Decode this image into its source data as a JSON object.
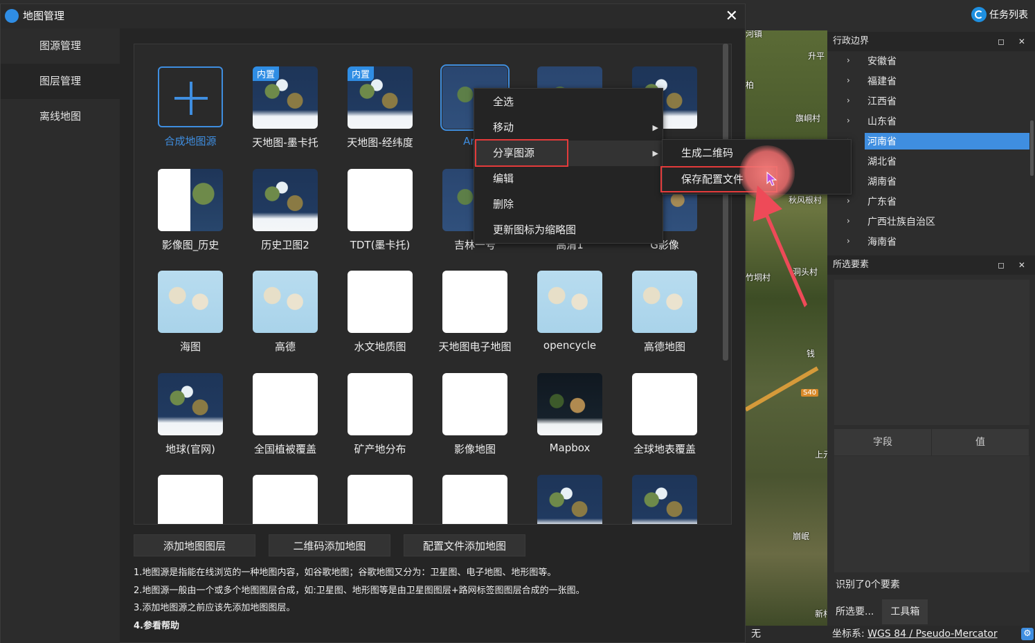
{
  "app": {
    "task_list_label": "任务列表"
  },
  "dialog": {
    "title": "地图管理",
    "close_glyph": "✕",
    "nav": [
      {
        "label": "图源管理"
      },
      {
        "label": "图层管理"
      },
      {
        "label": "离线地图"
      }
    ],
    "add_source_label": "合成地图源",
    "builtin_badge": "内置",
    "tiles": [
      {
        "label": "天地图-墨卡托",
        "builtin": true,
        "style": "sat"
      },
      {
        "label": "天地图-经纬度",
        "builtin": true,
        "style": "sat"
      },
      {
        "label": "Arcg",
        "builtin": false,
        "style": "sat2"
      },
      {
        "label": "",
        "builtin": false,
        "style": "sat2"
      },
      {
        "label": "",
        "builtin": false,
        "style": "sat"
      },
      {
        "label": "影像图_历史",
        "builtin": false,
        "style": "mix"
      },
      {
        "label": "历史卫图2",
        "builtin": false,
        "style": "sat"
      },
      {
        "label": "TDT(墨卡托)",
        "builtin": false,
        "style": "white"
      },
      {
        "label": "吉林一号",
        "builtin": false,
        "style": "sat2"
      },
      {
        "label": "高清1",
        "builtin": false,
        "style": "sat2"
      },
      {
        "label": "G影像",
        "builtin": false,
        "style": "sat2"
      },
      {
        "label": "海图",
        "builtin": false,
        "style": "light"
      },
      {
        "label": "高德",
        "builtin": false,
        "style": "light"
      },
      {
        "label": "水文地质图",
        "builtin": false,
        "style": "white"
      },
      {
        "label": "天地图电子地图",
        "builtin": false,
        "style": "white"
      },
      {
        "label": "opencycle",
        "builtin": false,
        "style": "light"
      },
      {
        "label": "高德地图",
        "builtin": false,
        "style": "light"
      },
      {
        "label": "地球(官网)",
        "builtin": false,
        "style": "sat"
      },
      {
        "label": "全国植被覆盖",
        "builtin": false,
        "style": "white"
      },
      {
        "label": "矿产地分布",
        "builtin": false,
        "style": "white"
      },
      {
        "label": "影像地图",
        "builtin": false,
        "style": "white"
      },
      {
        "label": "Mapbox",
        "builtin": false,
        "style": "dark"
      },
      {
        "label": "全球地表覆盖",
        "builtin": false,
        "style": "white"
      },
      {
        "label": "",
        "builtin": false,
        "style": "white"
      },
      {
        "label": "",
        "builtin": false,
        "style": "white"
      },
      {
        "label": "",
        "builtin": false,
        "style": "white"
      },
      {
        "label": "",
        "builtin": false,
        "style": "white"
      },
      {
        "label": "",
        "builtin": false,
        "style": "sat"
      },
      {
        "label": "",
        "builtin": false,
        "style": "sat"
      }
    ],
    "buttons": {
      "add_layer": "添加地图图层",
      "qr_add": "二维码添加地图",
      "config_add": "配置文件添加地图"
    },
    "notes": [
      "1.地图源是指能在线浏览的一种地图内容，如谷歌地图；谷歌地图又分为：卫星图、电子地图、地形图等。",
      "2.地图源一般由一个或多个地图图层合成，如:卫星图、地形图等是由卫星图图层+路网标签图图层合成的一张图。",
      "3.添加地图源之前应该先添加地图图层。",
      "4.参看帮助"
    ]
  },
  "context_menu": {
    "items": [
      {
        "label": "全选",
        "submenu": false
      },
      {
        "label": "移动",
        "submenu": true
      },
      {
        "label": "分享图源",
        "submenu": true
      },
      {
        "label": "编辑",
        "submenu": false
      },
      {
        "label": "删除",
        "submenu": false
      },
      {
        "label": "更新图标为缩略图",
        "submenu": false
      }
    ],
    "submenu_items": [
      {
        "label": "生成二维码"
      },
      {
        "label": "保存配置文件"
      }
    ]
  },
  "map_labels": [
    "河镇",
    "升平",
    "柏",
    "旗峒村",
    "秋风根村",
    "洞头村",
    "竹垌村",
    "钱",
    "上元珠",
    "崩岷",
    "新村"
  ],
  "map_road_badge": "S40",
  "right_panel": {
    "admin_title": "行政边界",
    "window_ctrls": "◻ ✕",
    "provinces": [
      {
        "label": "安徽省",
        "selected": false
      },
      {
        "label": "福建省",
        "selected": false
      },
      {
        "label": "江西省",
        "selected": false
      },
      {
        "label": "山东省",
        "selected": false
      },
      {
        "label": "河南省",
        "selected": true
      },
      {
        "label": "湖北省",
        "selected": false
      },
      {
        "label": "湖南省",
        "selected": false
      },
      {
        "label": "广东省",
        "selected": false
      },
      {
        "label": "广西壮族自治区",
        "selected": false
      },
      {
        "label": "海南省",
        "selected": false
      }
    ],
    "selected_title": "所选要素",
    "table_headers": [
      "字段",
      "值"
    ],
    "recognized": "识别了0个要素",
    "tabs": [
      {
        "label": "所选要...",
        "active": false
      },
      {
        "label": "工具箱",
        "active": true
      }
    ]
  },
  "statusbar": {
    "none": "无",
    "coord_prefix": "坐标系:",
    "coord_value": "WGS 84 / Pseudo-Mercator"
  },
  "colors": {
    "accent": "#3f8ee0",
    "highlight_red": "#e53b3b"
  }
}
